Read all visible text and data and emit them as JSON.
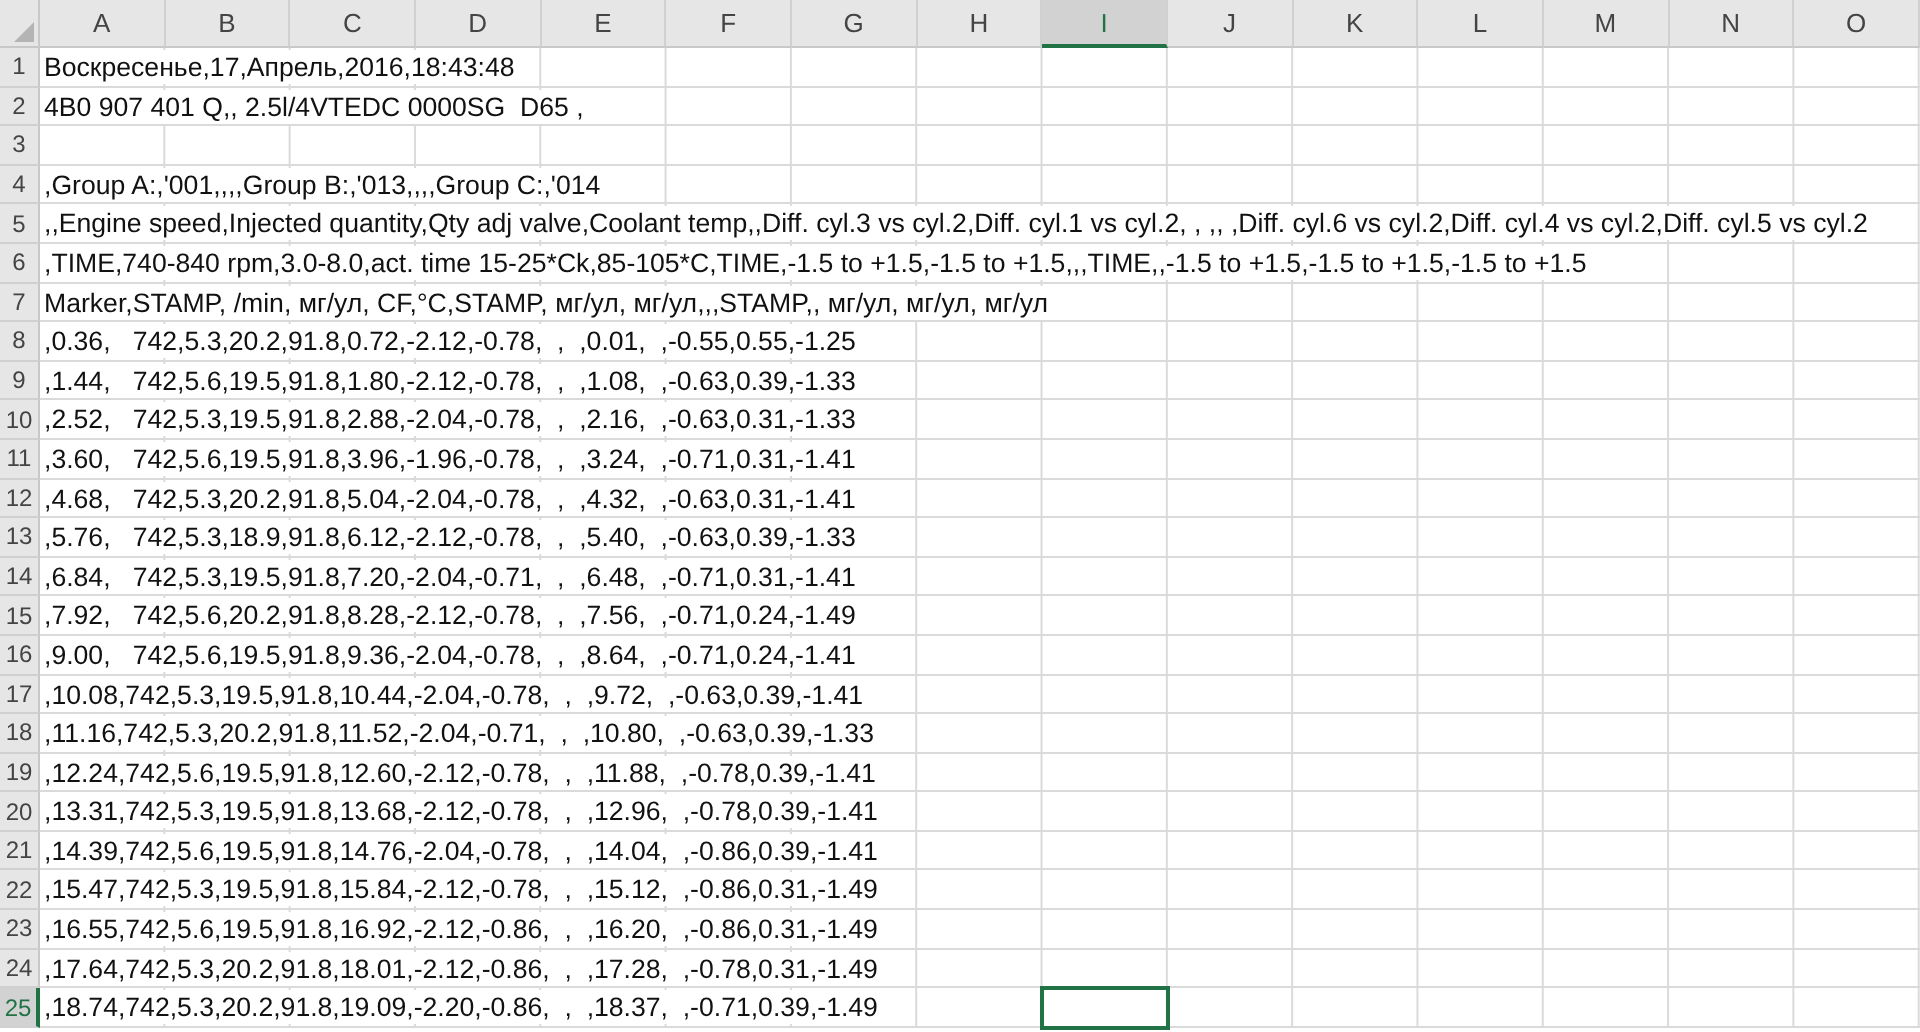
{
  "columns": [
    {
      "label": "A",
      "selected": false
    },
    {
      "label": "B",
      "selected": false
    },
    {
      "label": "C",
      "selected": false
    },
    {
      "label": "D",
      "selected": false
    },
    {
      "label": "E",
      "selected": false
    },
    {
      "label": "F",
      "selected": false
    },
    {
      "label": "G",
      "selected": false
    },
    {
      "label": "H",
      "selected": false
    },
    {
      "label": "I",
      "selected": true
    },
    {
      "label": "J",
      "selected": false
    },
    {
      "label": "K",
      "selected": false
    },
    {
      "label": "L",
      "selected": false
    },
    {
      "label": "M",
      "selected": false
    },
    {
      "label": "N",
      "selected": false
    },
    {
      "label": "O",
      "selected": false
    }
  ],
  "rows": [
    {
      "number": "1",
      "text": "Воскресенье,17,Апрель,2016,18:43:48",
      "selected": false
    },
    {
      "number": "2",
      "text": "4B0 907 401 Q,, 2.5l/4VTEDC 0000SG  D65 ,",
      "selected": false
    },
    {
      "number": "3",
      "selected": false
    },
    {
      "number": "4",
      "text": ",Group A:,'001,,,,Group B:,'013,,,,Group C:,'014",
      "selected": false
    },
    {
      "number": "5",
      "text": ",,Engine speed,Injected quantity,Qty adj valve,Coolant temp,,Diff. cyl.3 vs cyl.2,Diff. cyl.1 vs cyl.2, , ,, ,Diff. cyl.6 vs cyl.2,Diff. cyl.4 vs cyl.2,Diff. cyl.5 vs cyl.2",
      "selected": false
    },
    {
      "number": "6",
      "text": ",TIME,740-840 rpm,3.0-8.0,act. time 15-25*Ck,85-105*C,TIME,-1.5 to +1.5,-1.5 to +1.5,,,TIME,,-1.5 to +1.5,-1.5 to +1.5,-1.5 to +1.5",
      "selected": false
    },
    {
      "number": "7",
      "text": "Marker,STAMP, /min, мг/ул, CF,°C,STAMP, мг/ул, мг/ул,,,STAMP,, мг/ул, мг/ул, мг/ул",
      "selected": false
    },
    {
      "number": "8",
      "text": ",0.36,   742,5.3,20.2,91.8,0.72,-2.12,-0.78,  ,  ,0.01,  ,-0.55,0.55,-1.25",
      "selected": false
    },
    {
      "number": "9",
      "text": ",1.44,   742,5.6,19.5,91.8,1.80,-2.12,-0.78,  ,  ,1.08,  ,-0.63,0.39,-1.33",
      "selected": false
    },
    {
      "number": "10",
      "text": ",2.52,   742,5.3,19.5,91.8,2.88,-2.04,-0.78,  ,  ,2.16,  ,-0.63,0.31,-1.33",
      "selected": false
    },
    {
      "number": "11",
      "text": ",3.60,   742,5.6,19.5,91.8,3.96,-1.96,-0.78,  ,  ,3.24,  ,-0.71,0.31,-1.41",
      "selected": false
    },
    {
      "number": "12",
      "text": ",4.68,   742,5.3,20.2,91.8,5.04,-2.04,-0.78,  ,  ,4.32,  ,-0.63,0.31,-1.41",
      "selected": false
    },
    {
      "number": "13",
      "text": ",5.76,   742,5.3,18.9,91.8,6.12,-2.12,-0.78,  ,  ,5.40,  ,-0.63,0.39,-1.33",
      "selected": false
    },
    {
      "number": "14",
      "text": ",6.84,   742,5.3,19.5,91.8,7.20,-2.04,-0.71,  ,  ,6.48,  ,-0.71,0.31,-1.41",
      "selected": false
    },
    {
      "number": "15",
      "text": ",7.92,   742,5.6,20.2,91.8,8.28,-2.12,-0.78,  ,  ,7.56,  ,-0.71,0.24,-1.49",
      "selected": false
    },
    {
      "number": "16",
      "text": ",9.00,   742,5.6,19.5,91.8,9.36,-2.04,-0.78,  ,  ,8.64,  ,-0.71,0.24,-1.41",
      "selected": false
    },
    {
      "number": "17",
      "text": ",10.08,742,5.3,19.5,91.8,10.44,-2.04,-0.78,  ,  ,9.72,  ,-0.63,0.39,-1.41",
      "selected": false
    },
    {
      "number": "18",
      "text": ",11.16,742,5.3,20.2,91.8,11.52,-2.04,-0.71,  ,  ,10.80,  ,-0.63,0.39,-1.33",
      "selected": false
    },
    {
      "number": "19",
      "text": ",12.24,742,5.6,19.5,91.8,12.60,-2.12,-0.78,  ,  ,11.88,  ,-0.78,0.39,-1.41",
      "selected": false
    },
    {
      "number": "20",
      "text": ",13.31,742,5.3,19.5,91.8,13.68,-2.12,-0.78,  ,  ,12.96,  ,-0.78,0.39,-1.41",
      "selected": false
    },
    {
      "number": "21",
      "text": ",14.39,742,5.6,19.5,91.8,14.76,-2.04,-0.78,  ,  ,14.04,  ,-0.86,0.39,-1.41",
      "selected": false
    },
    {
      "number": "22",
      "text": ",15.47,742,5.3,19.5,91.8,15.84,-2.12,-0.78,  ,  ,15.12,  ,-0.86,0.31,-1.49",
      "selected": false
    },
    {
      "number": "23",
      "text": ",16.55,742,5.6,19.5,91.8,16.92,-2.12,-0.86,  ,  ,16.20,  ,-0.86,0.31,-1.49",
      "selected": false
    },
    {
      "number": "24",
      "text": ",17.64,742,5.3,20.2,91.8,18.01,-2.12,-0.86,  ,  ,17.28,  ,-0.78,0.31,-1.49",
      "selected": false
    },
    {
      "number": "25",
      "text": ",18.74,742,5.3,20.2,91.8,19.09,-2.20,-0.86,  ,  ,18.37,  ,-0.71,0.39,-1.49",
      "selected": true
    }
  ]
}
